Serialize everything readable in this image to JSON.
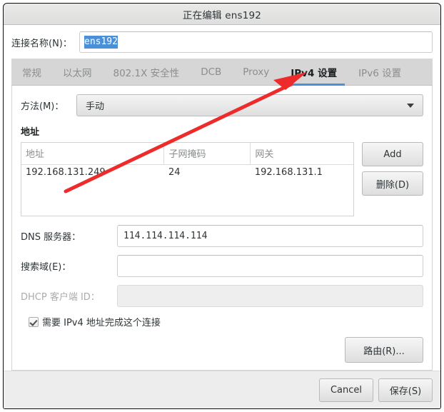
{
  "window": {
    "title": "正在编辑 ens192"
  },
  "connection": {
    "name_label": "连接名称(N)：",
    "name_value": "ens192"
  },
  "tabs": [
    {
      "label": "常规",
      "active": false
    },
    {
      "label": "以太网",
      "active": false
    },
    {
      "label": "802.1X 安全性",
      "active": false
    },
    {
      "label": "DCB",
      "active": false
    },
    {
      "label": "Proxy",
      "active": false
    },
    {
      "label": "IPv4 设置",
      "active": true
    },
    {
      "label": "IPv6 设置",
      "active": false
    }
  ],
  "ipv4": {
    "method_label": "方法(M)：",
    "method_value": "手动",
    "addresses_section_label": "地址",
    "table": {
      "columns": [
        "地址",
        "子网掩码",
        "网关"
      ],
      "rows": [
        [
          "192.168.131.249",
          "24",
          "192.168.131.1"
        ]
      ]
    },
    "add_button": "Add",
    "delete_button": "删除(D)",
    "dns_label": "DNS 服务器：",
    "dns_value": "114.114.114.114",
    "search_label": "搜索域(E)：",
    "search_value": "",
    "dhcp_label": "DHCP 客户端 ID：",
    "dhcp_value": "",
    "require_ipv4_label": "需要 IPv4 地址完成这个连接",
    "routes_button": "路由(R)..."
  },
  "footer": {
    "cancel_label": "Cancel",
    "save_label": "保存(S)"
  },
  "annotation": {
    "color": "#ee2b2b",
    "shape": "arrow-pointing-to-ipv4-tab"
  },
  "colors": {
    "accent": "#4a90d9",
    "selection": "#4a90d9",
    "annotation_red": "#ee2b2b",
    "window_bg": "#ededed",
    "tabbar_bg": "#d6d6d6"
  }
}
